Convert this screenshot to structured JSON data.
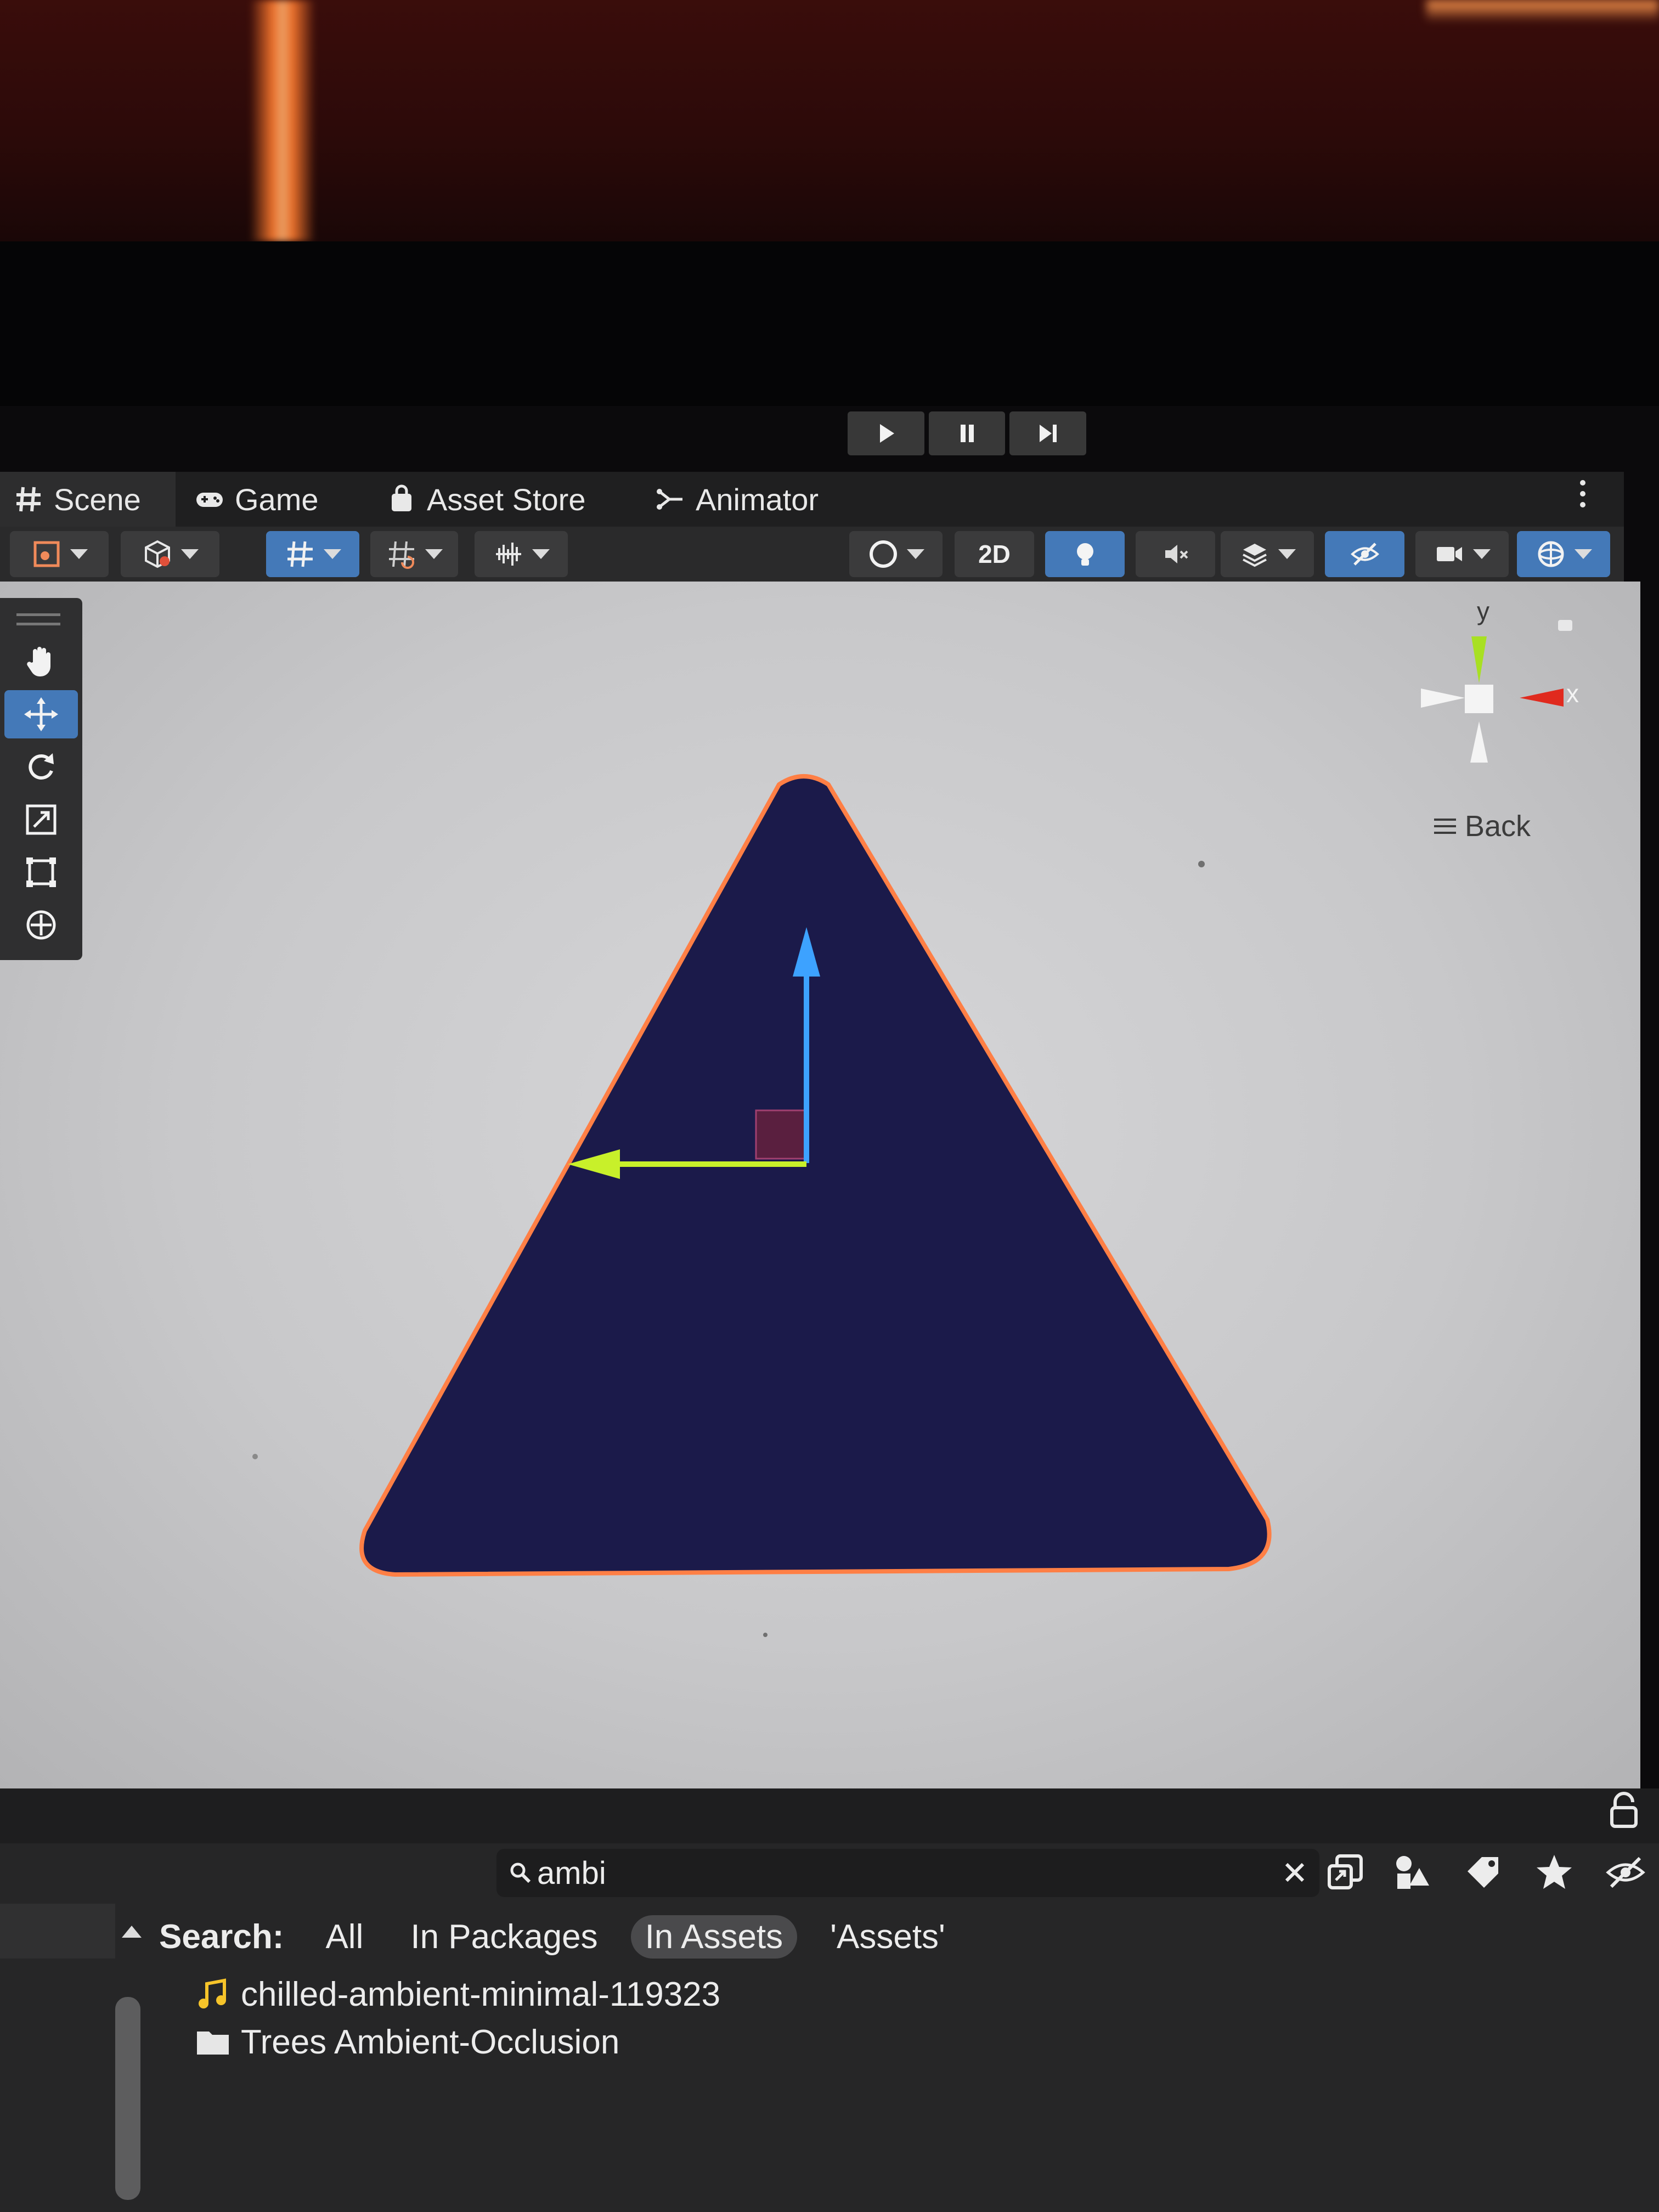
{
  "play_controls": [
    {
      "icon": "play-icon"
    },
    {
      "icon": "pause-icon"
    },
    {
      "icon": "step-icon"
    }
  ],
  "tabs": [
    {
      "label": "Scene",
      "icon": "grid-icon",
      "active": true
    },
    {
      "label": "Game",
      "icon": "gamepad-icon",
      "active": false
    },
    {
      "label": "Asset Store",
      "icon": "shopping-bag-icon",
      "active": false
    },
    {
      "label": "Animator",
      "icon": "animator-icon",
      "active": false
    }
  ],
  "scene_toolbar": {
    "two_d_label": "2D",
    "active_toggles": [
      "grid-snap",
      "2d",
      "lighting",
      "visibility",
      "gizmos"
    ]
  },
  "tools": [
    {
      "icon": "hand-icon",
      "active": false
    },
    {
      "icon": "move-icon",
      "active": true
    },
    {
      "icon": "rotate-icon",
      "active": false
    },
    {
      "icon": "scale-icon",
      "active": false
    },
    {
      "icon": "rect-tool-icon",
      "active": false
    },
    {
      "icon": "transform-icon",
      "active": false
    }
  ],
  "gizmo": {
    "y_label": "y",
    "x_label": "x",
    "back_label": "Back",
    "colors": {
      "x": "#e02a1e",
      "y": "#a8e022",
      "z": "#f4f4f4"
    }
  },
  "scene": {
    "object_fill": "#1b1a4a",
    "outline_color": "#ff7f45",
    "axis_colors": {
      "x": "#c8f02a",
      "y": "#3da2ff"
    }
  },
  "search": {
    "query": "ambi"
  },
  "search_filters": {
    "label": "Search:",
    "options": [
      "All",
      "In Packages",
      "In Assets",
      "'Assets'"
    ],
    "selected": "In Assets"
  },
  "results": [
    {
      "name": "chilled-ambient-minimal-119323",
      "icon": "audio-clip-icon"
    },
    {
      "name": "Trees Ambient-Occlusion",
      "icon": "folder-icon"
    }
  ]
}
